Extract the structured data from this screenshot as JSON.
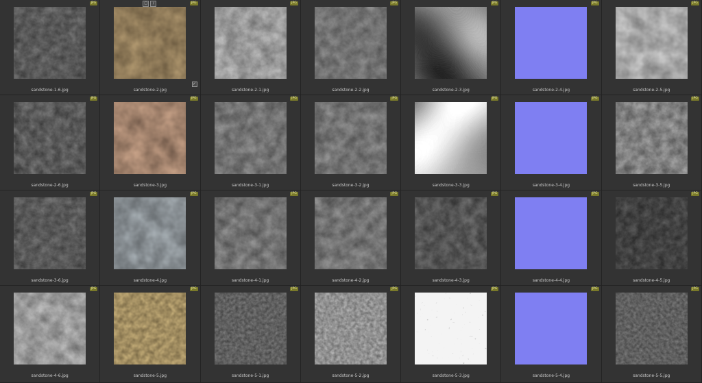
{
  "badge_label": "JPG",
  "icons": {
    "frame": "crop-icon",
    "brush": "brush-icon",
    "check": "check-icon"
  },
  "colors": {
    "normal_map": "#7f7ff2",
    "badge_bg": "#7a7a2a"
  },
  "cells": [
    {
      "name": "sandstone-1-6.jpg",
      "kind": "dark-noise"
    },
    {
      "name": "sandstone-2.jpg",
      "kind": "tan",
      "selected": true
    },
    {
      "name": "sandstone-2-1.jpg",
      "kind": "light-gray"
    },
    {
      "name": "sandstone-2-2.jpg",
      "kind": "mid-gray"
    },
    {
      "name": "sandstone-2-3.jpg",
      "kind": "blotch"
    },
    {
      "name": "sandstone-2-4.jpg",
      "kind": "normal"
    },
    {
      "name": "sandstone-2-5.jpg",
      "kind": "pale-gray"
    },
    {
      "name": "sandstone-2-6.jpg",
      "kind": "dark-noise"
    },
    {
      "name": "sandstone-3.jpg",
      "kind": "peach"
    },
    {
      "name": "sandstone-3-1.jpg",
      "kind": "mid-gray"
    },
    {
      "name": "sandstone-3-2.jpg",
      "kind": "mid-gray"
    },
    {
      "name": "sandstone-3-3.jpg",
      "kind": "white-blotch"
    },
    {
      "name": "sandstone-3-4.jpg",
      "kind": "normal"
    },
    {
      "name": "sandstone-3-5.jpg",
      "kind": "contrast-gray"
    },
    {
      "name": "sandstone-3-6.jpg",
      "kind": "dark-noise"
    },
    {
      "name": "sandstone-4.jpg",
      "kind": "blue-gray"
    },
    {
      "name": "sandstone-4-1.jpg",
      "kind": "mid-gray"
    },
    {
      "name": "sandstone-4-2.jpg",
      "kind": "mid-gray"
    },
    {
      "name": "sandstone-4-3.jpg",
      "kind": "dark-gray"
    },
    {
      "name": "sandstone-4-4.jpg",
      "kind": "normal"
    },
    {
      "name": "sandstone-4-5.jpg",
      "kind": "very-dark"
    },
    {
      "name": "sandstone-4-6.jpg",
      "kind": "light-gray"
    },
    {
      "name": "sandstone-5.jpg",
      "kind": "sand"
    },
    {
      "name": "sandstone-5-1.jpg",
      "kind": "fine-noise"
    },
    {
      "name": "sandstone-5-2.jpg",
      "kind": "pale-fine"
    },
    {
      "name": "sandstone-5-3.jpg",
      "kind": "white-speck"
    },
    {
      "name": "sandstone-5-4.jpg",
      "kind": "normal"
    },
    {
      "name": "sandstone-5-5.jpg",
      "kind": "fine-noise"
    }
  ]
}
